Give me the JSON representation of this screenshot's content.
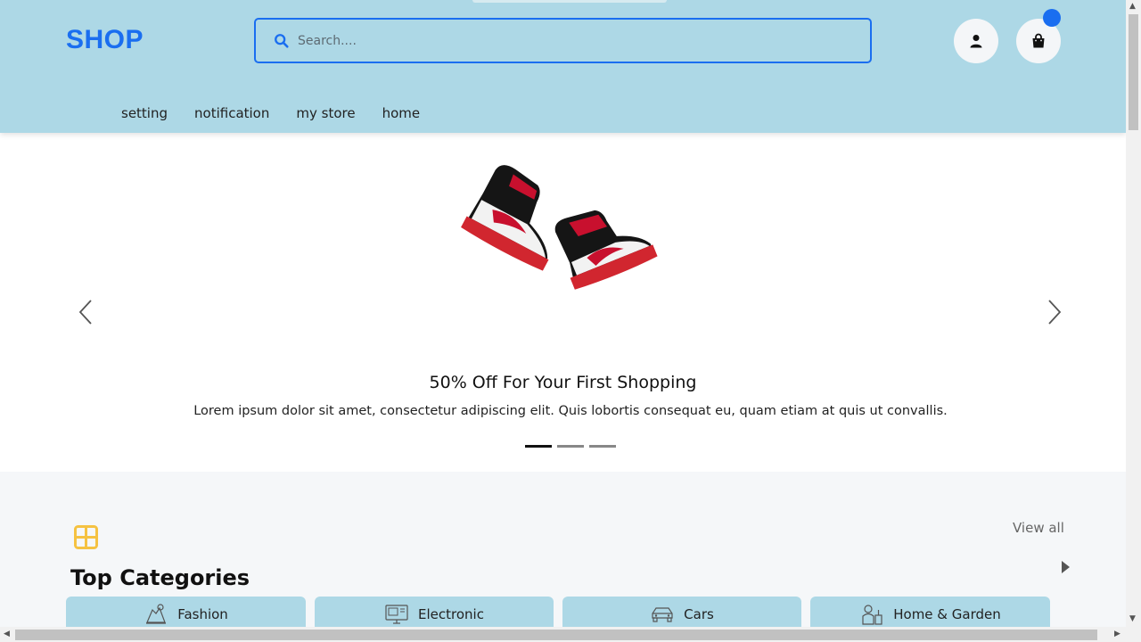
{
  "header": {
    "logo": "SHOP",
    "search": {
      "placeholder": "Search...."
    },
    "nav": [
      "setting",
      "notification",
      "my store",
      "home"
    ],
    "user_icon": "user-icon",
    "cart_icon": "shopping-bag-icon",
    "accent_color": "#1a6ef0",
    "background_color": "#add8e6"
  },
  "hero": {
    "title": "50% Off For Your First Shopping",
    "text": "Lorem ipsum dolor sit amet, consectetur adipiscing elit. Quis lobortis consequat eu, quam etiam at quis ut convallis.",
    "slide_count": 3,
    "active_slide": 1
  },
  "categories": {
    "title": "Top Categories",
    "view_all": "View all",
    "items": [
      {
        "label": "Fashion",
        "icon": "fashion-icon"
      },
      {
        "label": "Electronic",
        "icon": "electronic-icon"
      },
      {
        "label": "Cars",
        "icon": "car-icon"
      },
      {
        "label": "Home & Garden",
        "icon": "home-garden-icon"
      }
    ]
  }
}
